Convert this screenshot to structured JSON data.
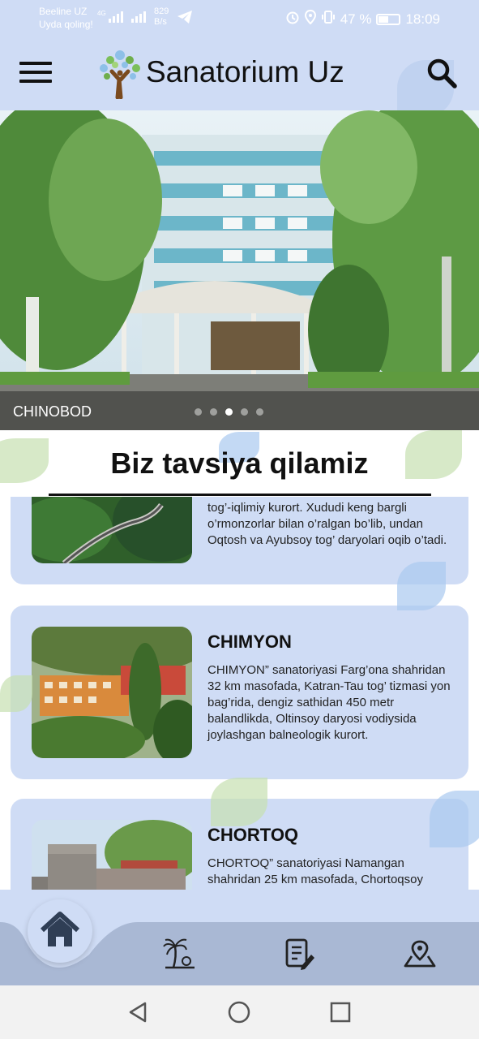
{
  "status_bar": {
    "carrier": "Beeline UZ",
    "carrier_sub": "Uyda qoling!",
    "net_4g": "4G",
    "speed_value": "829",
    "speed_unit": "B/s",
    "battery": "47 %",
    "time": "18:09"
  },
  "app_bar": {
    "title": "Sanatorium Uz",
    "menu_icon": "menu-icon",
    "search_icon": "search-icon"
  },
  "hero": {
    "caption": "CHINOBOD",
    "dots_total": 5,
    "active_dot": 3
  },
  "section": {
    "title": "Biz tavsiya qilamiz"
  },
  "cards": [
    {
      "name": "",
      "text": "tog’-iqlimiy kurort. Xududi keng bargli o’rmonzorlar bilan o’ralgan bo’lib, undan Oqtosh va Ayubsoy tog’ daryolari oqib o’tadi."
    },
    {
      "name": "CHIMYON",
      "text": "CHIMYON” sanatoriyasi Farg’ona shahridan 32 km masofada, Katran-Tau tog’ tizmasi yon bag’rida, dengiz sathidan 450 metr balandlikda, Oltinsoy daryosi vodiysida joylashgan balneologik kurort."
    },
    {
      "name": "CHORTOQ",
      "text": "CHORTOQ” sanatoriyasi Namangan shahridan 25 km masofada, Chortoqsoy"
    }
  ],
  "bottom_nav": {
    "items": [
      "home-icon",
      "palm-beach-icon",
      "document-edit-icon",
      "map-pin-icon"
    ]
  },
  "colors": {
    "accent_bg": "#cfdcf5",
    "nav_bar": "#a9b8d4",
    "icon_dark": "#2f3e55"
  }
}
